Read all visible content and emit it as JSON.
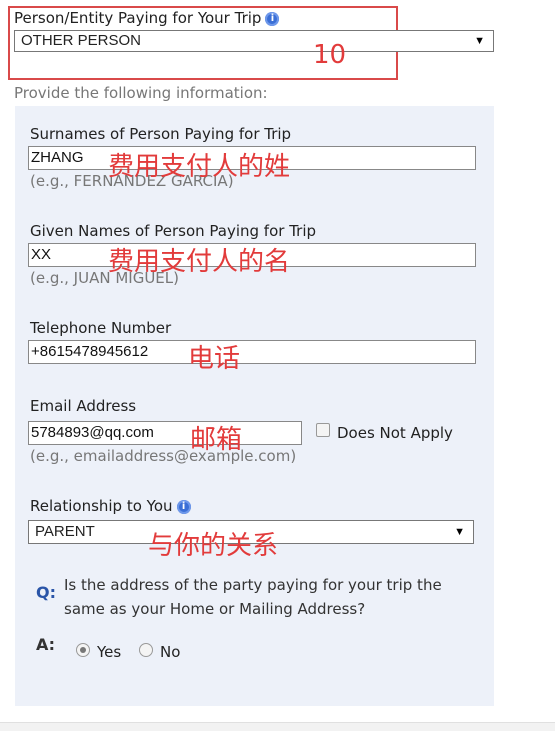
{
  "payer_section": {
    "label": "Person/Entity Paying for Your Trip",
    "selected": "OTHER PERSON",
    "annotation": "10"
  },
  "instructions": "Provide the following information:",
  "fields": {
    "surname": {
      "label": "Surnames of Person Paying for Trip",
      "value": "ZHANG",
      "hint": "(e.g., FERNANDEZ GARCIA)",
      "annotation": "费用支付人的姓"
    },
    "given_names": {
      "label": "Given Names of Person Paying for Trip",
      "value": "XX",
      "hint": "(e.g., JUAN MIGUEL)",
      "annotation": "费用支付人的名"
    },
    "telephone": {
      "label": "Telephone Number",
      "value": "+8615478945612",
      "annotation": "电话"
    },
    "email": {
      "label": "Email Address",
      "value": "5784893@qq.com",
      "hint": "(e.g., emailaddress@example.com)",
      "annotation": "邮箱",
      "does_not_apply_label": "Does Not Apply"
    },
    "relationship": {
      "label": "Relationship to You",
      "selected": "PARENT",
      "annotation": "与你的关系"
    }
  },
  "question": {
    "q_marker": "Q:",
    "text_line1": "Is the address of the party paying for your trip the",
    "text_line2": "same as your Home or Mailing Address?",
    "a_marker": "A:",
    "yes_label": "Yes",
    "no_label": "No",
    "selected": "Yes"
  },
  "icons": {
    "help": "info-icon"
  },
  "colors": {
    "annotation": "#e23b3b",
    "panel": "#edf1f9",
    "help_icon": "#3b6fd6"
  }
}
